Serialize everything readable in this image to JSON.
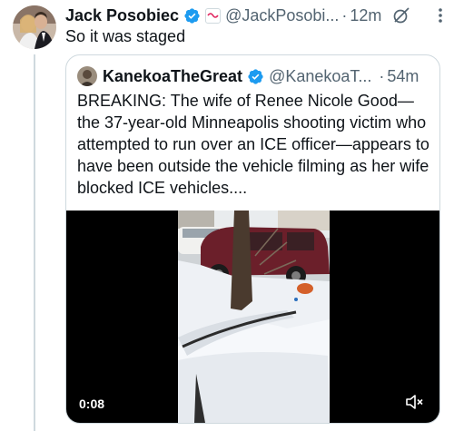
{
  "post": {
    "author_name": "Jack Posobiec",
    "handle": "@JackPosobi...",
    "separator": "·",
    "time": "12m",
    "text": "So it was staged",
    "avatar_icon": "profile-photo",
    "more_icon": "more-vertical-icon",
    "grok_icon": "grok-icon"
  },
  "quote": {
    "author_name": "KanekoaTheGreat",
    "handle": "@KanekoaT...",
    "separator": "·",
    "time": "54m",
    "text": "BREAKING: The wife of Renee Nicole Good—the 37-year-old Minneapolis shooting victim who attempted to run over an ICE officer—appears to have been outside the vehicle filming as her wife blocked ICE vehicles....",
    "video": {
      "elapsed": "0:08",
      "muted": true
    }
  },
  "colors": {
    "text": "#0f1419",
    "secondary": "#536471",
    "border": "#cfd9de",
    "verified": "#1d9bf0"
  }
}
